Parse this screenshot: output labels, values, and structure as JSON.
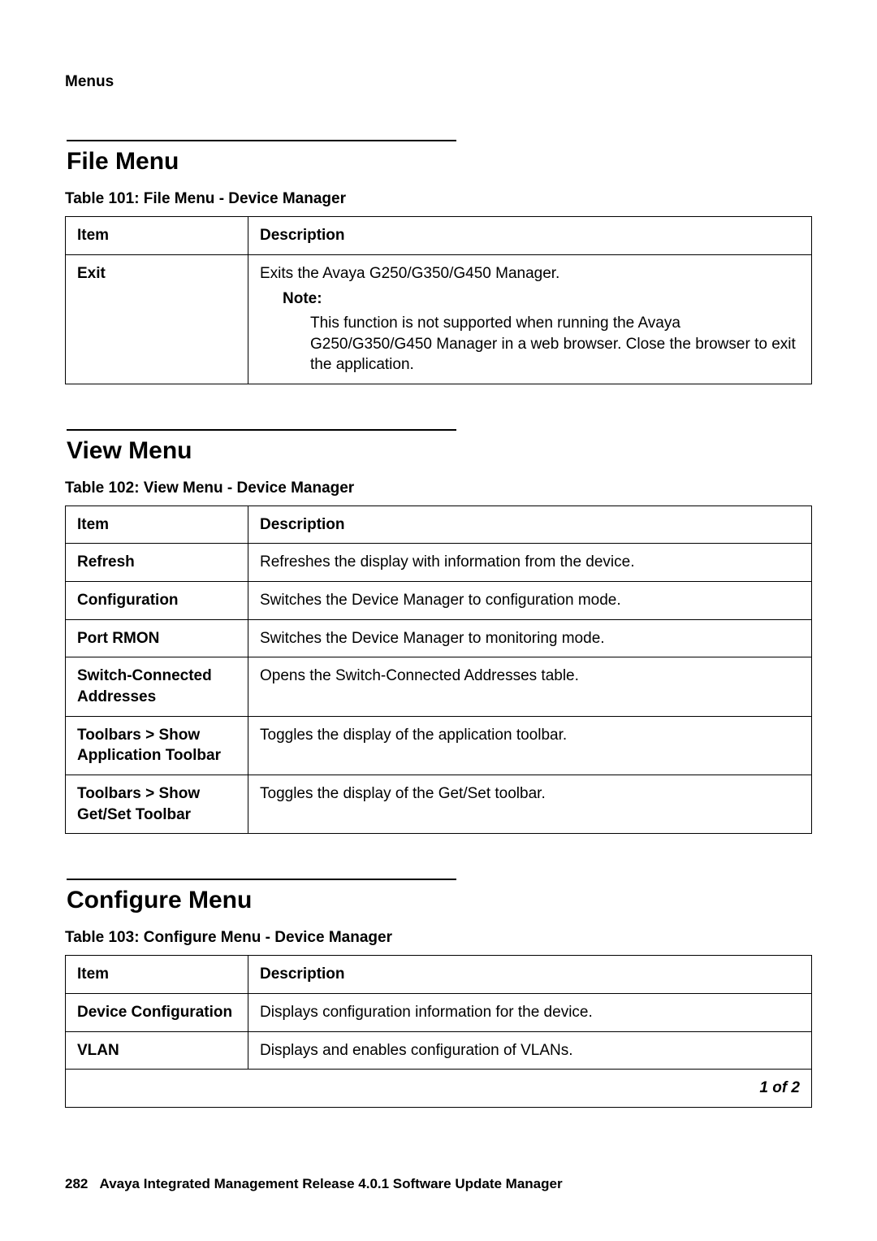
{
  "header": "Menus",
  "sections": [
    {
      "heading": "File Menu",
      "caption": "Table 101: File Menu - Device Manager",
      "columns": [
        "Item",
        "Description"
      ],
      "rows": [
        {
          "item": "Exit",
          "description": "Exits the Avaya G250/G350/G450 Manager.",
          "note_label": "Note:",
          "note_text": "This function is not supported when running the Avaya G250/G350/G450 Manager in a web browser. Close the browser to exit the application."
        }
      ]
    },
    {
      "heading": "View Menu",
      "caption": "Table 102: View Menu - Device Manager",
      "columns": [
        "Item",
        "Description"
      ],
      "rows": [
        {
          "item": "Refresh",
          "description": "Refreshes the display with information from the device."
        },
        {
          "item": "Configuration",
          "description": "Switches the Device Manager to configuration mode."
        },
        {
          "item": "Port RMON",
          "description": "Switches the Device Manager to monitoring mode."
        },
        {
          "item": "Switch-Connected Addresses",
          "description": "Opens the Switch-Connected Addresses table."
        },
        {
          "item": "Toolbars > Show Application Toolbar",
          "description": "Toggles the display of the application toolbar."
        },
        {
          "item": "Toolbars > Show Get/Set Toolbar",
          "description": "Toggles the display of the Get/Set toolbar."
        }
      ]
    },
    {
      "heading": "Configure Menu",
      "caption": "Table 103: Configure Menu - Device Manager",
      "columns": [
        "Item",
        "Description"
      ],
      "rows": [
        {
          "item": "Device Configuration",
          "description": "Displays configuration information for the device."
        },
        {
          "item": "VLAN",
          "description": "Displays and enables configuration of VLANs."
        }
      ],
      "pagination": "1 of 2"
    }
  ],
  "footer": {
    "page_number": "282",
    "title": "Avaya Integrated Management Release 4.0.1 Software Update Manager"
  }
}
